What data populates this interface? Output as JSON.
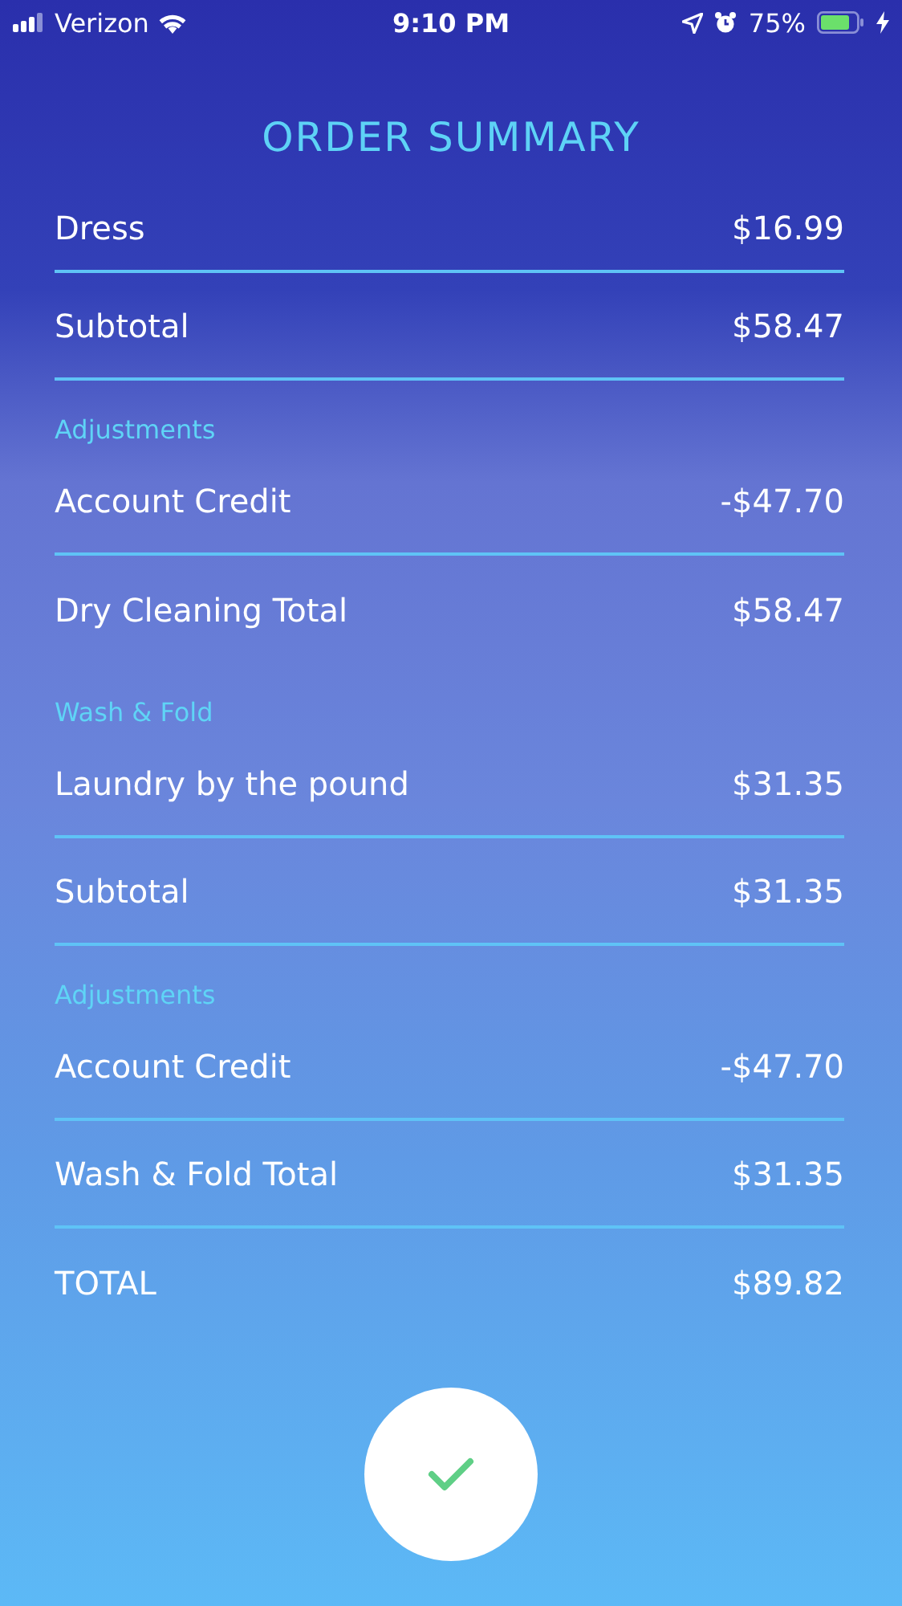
{
  "status_bar": {
    "carrier": "Verizon",
    "time": "9:10 PM",
    "battery": "75%"
  },
  "title": "ORDER SUMMARY",
  "lines": [
    {
      "kind": "row",
      "label": "Dress",
      "amount": "$16.99",
      "divider": true
    },
    {
      "kind": "row",
      "label": "Subtotal",
      "amount": "$58.47",
      "divider": true
    },
    {
      "kind": "section",
      "label": "Adjustments"
    },
    {
      "kind": "row",
      "label": "Account Credit",
      "amount": "-$47.70",
      "divider": true
    },
    {
      "kind": "row",
      "label": "Dry Cleaning Total",
      "amount": "$58.47",
      "divider": false
    },
    {
      "kind": "section",
      "label": "Wash & Fold"
    },
    {
      "kind": "row",
      "label": "Laundry by the pound",
      "amount": "$31.35",
      "divider": true
    },
    {
      "kind": "row",
      "label": "Subtotal",
      "amount": "$31.35",
      "divider": true
    },
    {
      "kind": "section",
      "label": "Adjustments"
    },
    {
      "kind": "row",
      "label": "Account Credit",
      "amount": "-$47.70",
      "divider": true
    },
    {
      "kind": "row",
      "label": "Wash & Fold Total",
      "amount": "$31.35",
      "divider": true
    },
    {
      "kind": "row",
      "label": "TOTAL",
      "amount": "$89.82",
      "divider": false
    }
  ]
}
